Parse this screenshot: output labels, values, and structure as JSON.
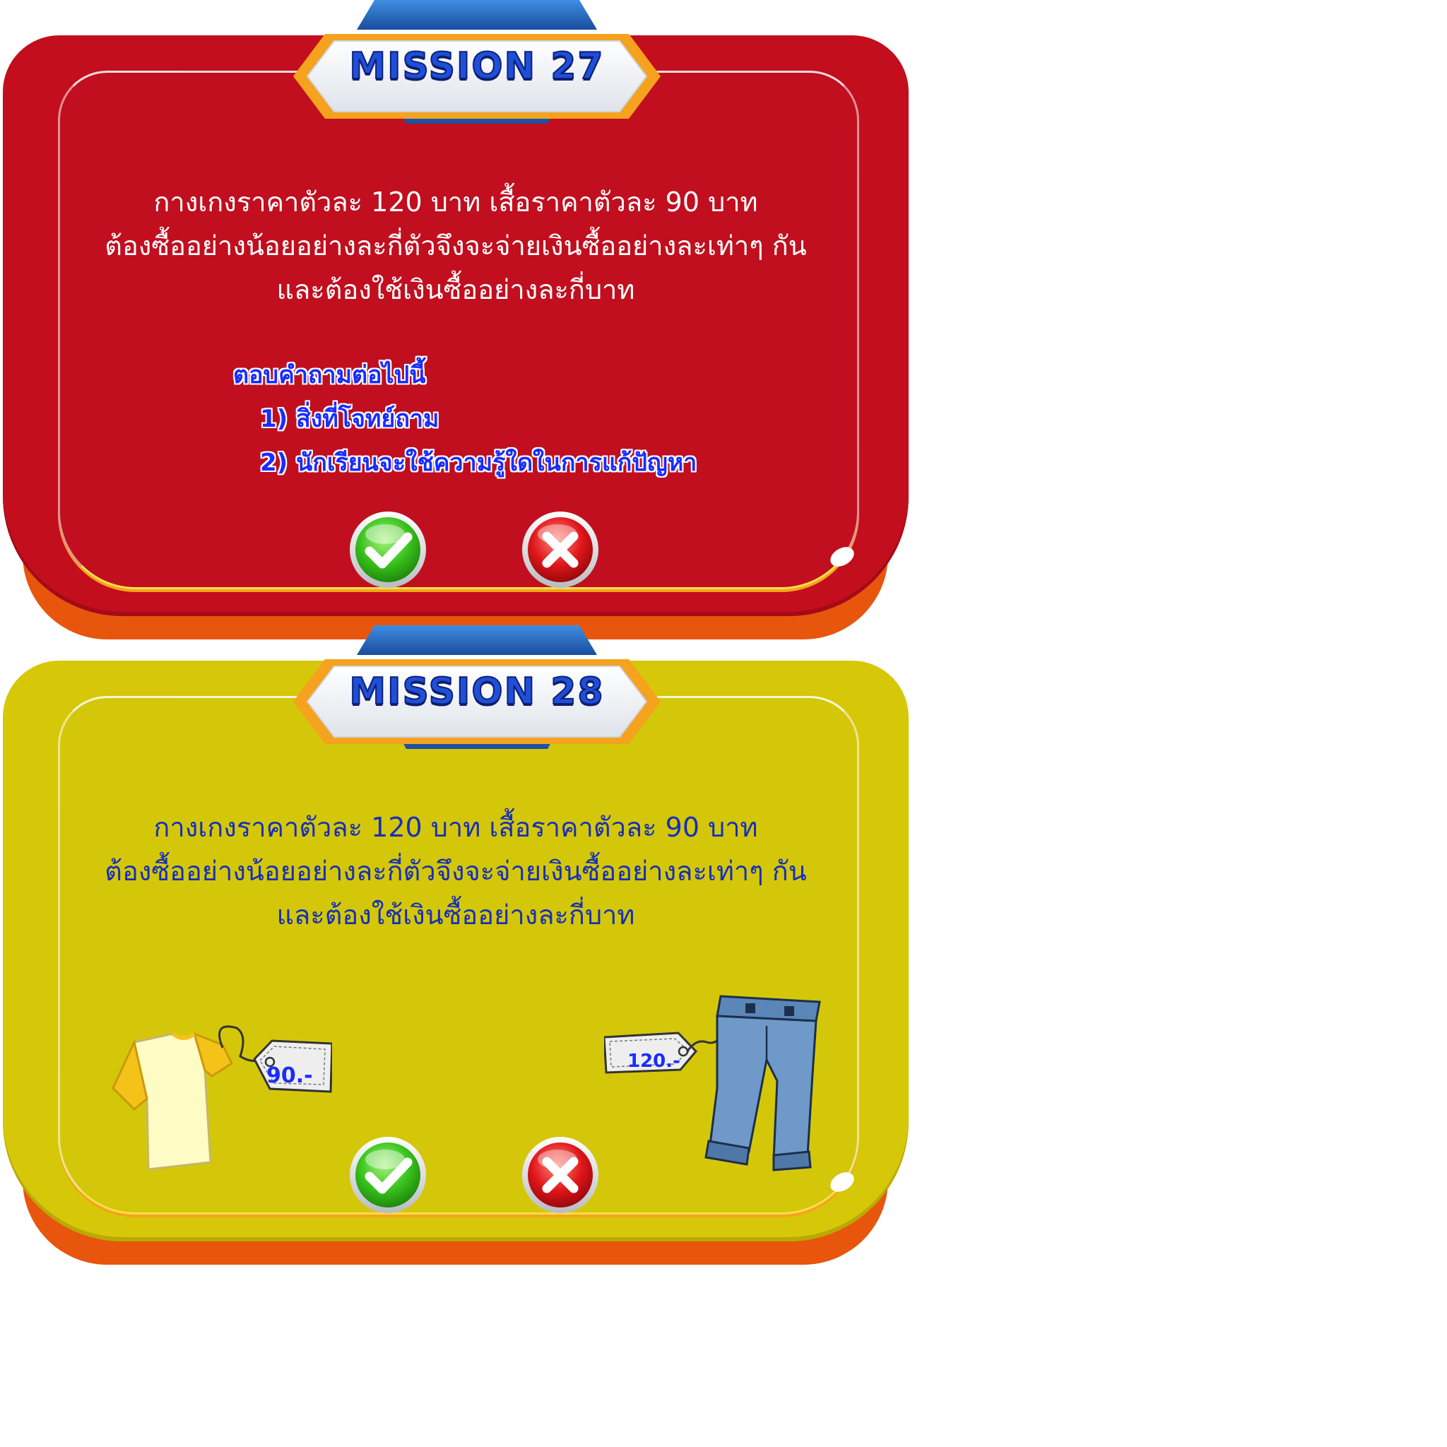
{
  "missions": [
    {
      "title": "MISSION 27",
      "question_lines": [
        "กางเกงราคาตัวละ 120 บาท เสื้อราคาตัวละ 90 บาท",
        "ต้องซื้ออย่างน้อยอย่างละกี่ตัวจึงจะจ่ายเงินซื้ออย่างละเท่าๆ กัน",
        "และต้องใช้เงินซื้ออย่างละกี่บาท"
      ],
      "prompt": {
        "heading": "ตอบคำถามต่อไปนี้",
        "items": [
          "1) สิ่งที่โจทย์ถาม",
          "2) นักเรียนจะใช้ความรู้ใดในการแก้ปัญหา"
        ]
      },
      "theme_color": "#c10f1f"
    },
    {
      "title": "MISSION 28",
      "question_lines": [
        "กางเกงราคาตัวละ 120 บาท เสื้อราคาตัวละ 90 บาท",
        "ต้องซื้ออย่างน้อยอย่างละกี่ตัวจึงจะจ่ายเงินซื้ออย่างละเท่าๆ กัน",
        "และต้องใช้เงินซื้ออย่างละกี่บาท"
      ],
      "shirt_price_tag": "90.-",
      "pants_price_tag": "120.-",
      "theme_color": "#d4c70a"
    }
  ],
  "icons": {
    "confirm": "check-icon",
    "cancel": "x-icon"
  },
  "colors": {
    "banner_blue": "#1f4fd6",
    "banner_orange": "#f5a21f",
    "card_base_orange": "#e8550c",
    "prompt_blue": "#1a2cff",
    "button_green": "#37c21a",
    "button_red": "#d81418"
  }
}
